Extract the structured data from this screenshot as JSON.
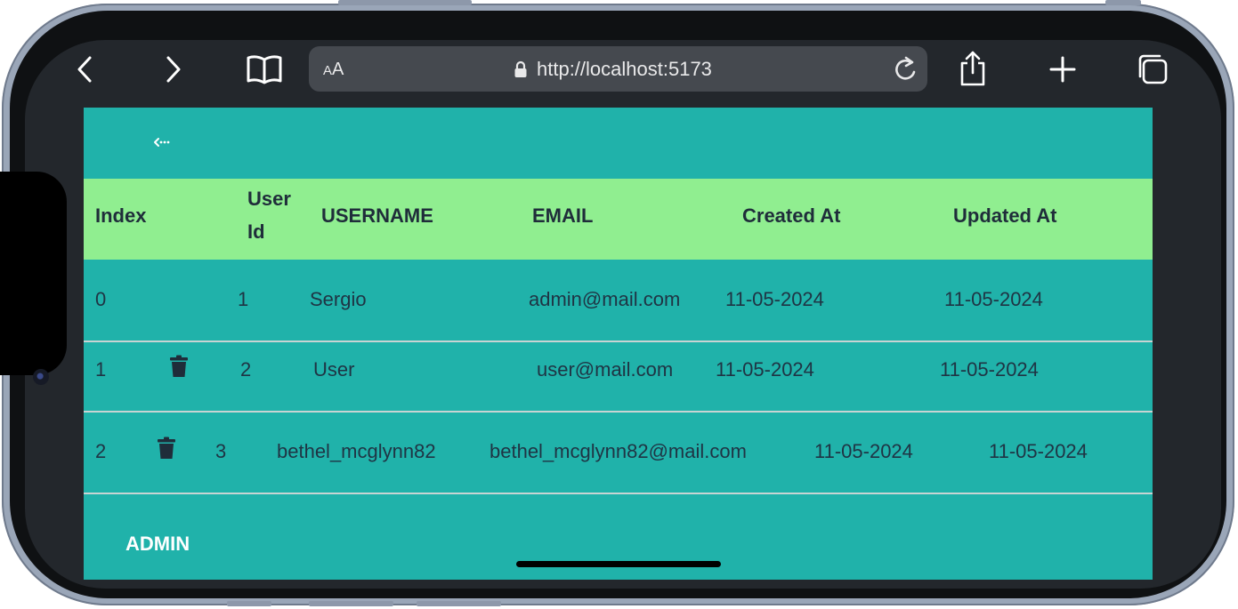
{
  "browser": {
    "text_size_label_small": "A",
    "text_size_label_large": "A",
    "url": "http://localhost:5173"
  },
  "table": {
    "headers": {
      "index": "Index",
      "user_id_line1": "User",
      "user_id_line2": "Id",
      "username": "USERNAME",
      "email": "EMAIL",
      "created_at": "Created At",
      "updated_at": "Updated At"
    },
    "rows": [
      {
        "index": "0",
        "user_id": "1",
        "username": "Sergio",
        "email": "admin@mail.com",
        "created_at": "11-05-2024",
        "updated_at": "11-05-2024",
        "delete_icon": false
      },
      {
        "index": "1",
        "user_id": "2",
        "username": "User",
        "email": "user@mail.com",
        "created_at": "11-05-2024",
        "updated_at": "11-05-2024",
        "delete_icon": true
      },
      {
        "index": "2",
        "user_id": "3",
        "username": "bethel_mcglynn82",
        "email": "bethel_mcglynn82@mail.com",
        "created_at": "11-05-2024",
        "updated_at": "11-05-2024",
        "delete_icon": true
      }
    ]
  },
  "footer": {
    "admin_label": "ADMIN"
  },
  "colors": {
    "page_background": "#20b2aa",
    "header_background": "#90ee90",
    "text": "#1f3444"
  }
}
